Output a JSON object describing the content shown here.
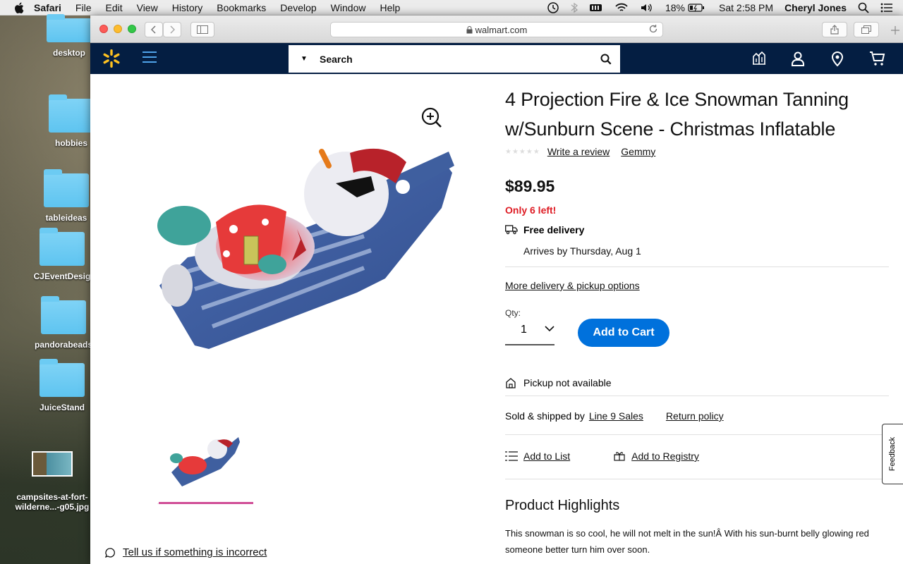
{
  "menubar": {
    "app": "Safari",
    "items": [
      "File",
      "Edit",
      "View",
      "History",
      "Bookmarks",
      "Develop",
      "Window",
      "Help"
    ],
    "battery": "18%",
    "clock": "Sat 2:58 PM",
    "user": "Cheryl Jones"
  },
  "desktop": {
    "icons": [
      {
        "label": "desktop"
      },
      {
        "label": "hobbies"
      },
      {
        "label": "tableideas"
      },
      {
        "label": "CJEventDesig"
      },
      {
        "label": "pandorabeads"
      },
      {
        "label": "JuiceStand"
      },
      {
        "label": "campsites-at-fort-\nwilderne...-g05.jpg"
      }
    ]
  },
  "browser": {
    "url": "walmart.com"
  },
  "header": {
    "search_placeholder": "Search"
  },
  "product": {
    "title": "4 Projection Fire & Ice Snowman Tanning w/Sunburn Scene - Christmas Inflatable",
    "rating_stars": 0,
    "write_review": "Write a review",
    "brand": "Gemmy",
    "price": "$89.95",
    "stock": "Only 6 left!",
    "delivery_label": "Free delivery",
    "arrives": "Arrives by Thursday, Aug 1",
    "more_options": "More delivery & pickup options",
    "qty_label": "Qty:",
    "qty_value": "1",
    "add_to_cart": "Add to Cart",
    "pickup": "Pickup not available",
    "sold_by_prefix": "Sold & shipped by",
    "seller": "Line 9 Sales",
    "return_policy": "Return policy",
    "add_to_list": "Add to List",
    "add_to_registry": "Add to Registry",
    "highlights_title": "Product Highlights",
    "highlights_text_1": "This snowman is so cool, he will not melt in the sun!Â  With his sun-burnt belly glowing red",
    "highlights_text_2": "someone better turn him over soon.",
    "incorrect": "Tell us if something is incorrect",
    "feedback": "Feedback"
  },
  "colors": {
    "walmart_navy": "#041e42",
    "walmart_blue": "#0071dc",
    "spark_yellow": "#ffc220",
    "stock_red": "#de1c24",
    "thumb_pink": "#d04d96"
  }
}
